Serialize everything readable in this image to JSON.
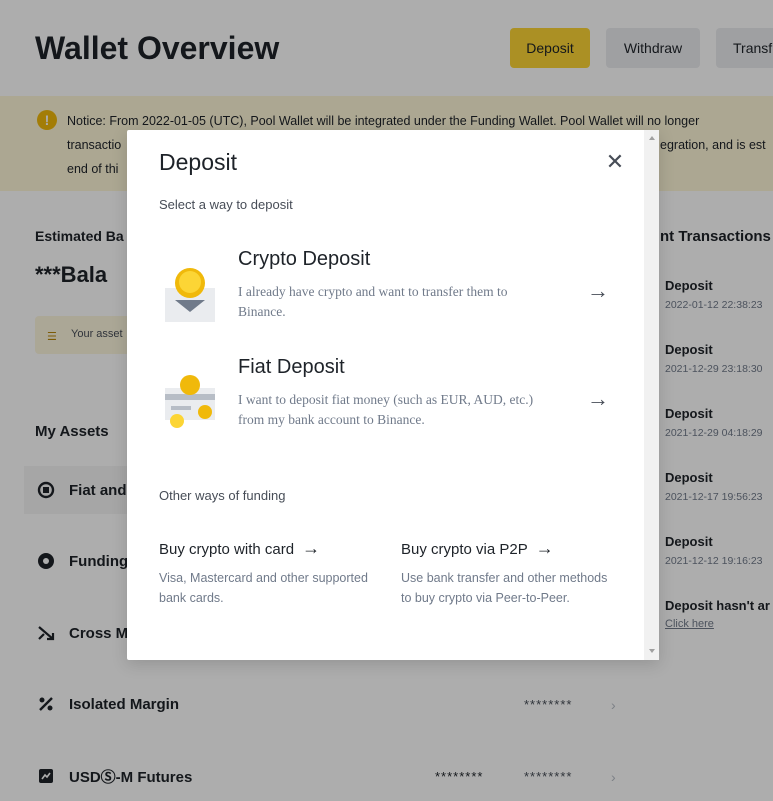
{
  "header": {
    "title": "Wallet Overview",
    "deposit_label": "Deposit",
    "withdraw_label": "Withdraw",
    "transfer_label": "Transf"
  },
  "notice": {
    "line1": "Notice: From 2022-01-05 (UTC), Pool Wallet will be integrated under the Funding Wallet. Pool Wallet will no longer",
    "line2_start": "transactio",
    "line2_end": "egration, and is est",
    "line3": "end of thi"
  },
  "balance": {
    "label": "Estimated Ba",
    "value": "***Bala",
    "tip": "Your asset"
  },
  "assets": {
    "title": "My Assets",
    "rows": [
      {
        "label": "Fiat and"
      },
      {
        "label": "Funding"
      },
      {
        "label": "Cross M"
      },
      {
        "label": "Isolated Margin",
        "value": "********"
      },
      {
        "label": "USDⓈ-M Futures",
        "value1": "********",
        "value2": "********"
      }
    ]
  },
  "transactions": {
    "title": "nt Transactions",
    "items": [
      {
        "type": "Deposit",
        "time": "2022-01-12 22:38:23"
      },
      {
        "type": "Deposit",
        "time": "2021-12-29 23:18:30"
      },
      {
        "type": "Deposit",
        "time": "2021-12-29 04:18:29"
      },
      {
        "type": "Deposit",
        "time": "2021-12-17 19:56:23"
      },
      {
        "type": "Deposit",
        "time": "2021-12-12 19:16:23"
      }
    ],
    "help_text": "Deposit hasn't ar",
    "help_link": "Click here"
  },
  "modal": {
    "title": "Deposit",
    "subtitle": "Select a way to deposit",
    "close_icon": "close-icon",
    "options": [
      {
        "title": "Crypto Deposit",
        "desc": "I already have crypto and want to transfer them to Binance."
      },
      {
        "title": "Fiat Deposit",
        "desc": "I want to deposit fiat money (such as EUR, AUD, etc.) from my bank account to Binance."
      }
    ],
    "other_label": "Other ways of funding",
    "funding": [
      {
        "title": "Buy crypto with card",
        "desc": "Visa, Mastercard and other supported bank cards."
      },
      {
        "title": "Buy crypto via P2P",
        "desc": "Use bank transfer and other methods to buy crypto via Peer-to-Peer."
      }
    ]
  },
  "colors": {
    "accent": "#fcd535",
    "gold": "#f0b90b",
    "text": "#1e2329",
    "muted": "#707a8a"
  }
}
